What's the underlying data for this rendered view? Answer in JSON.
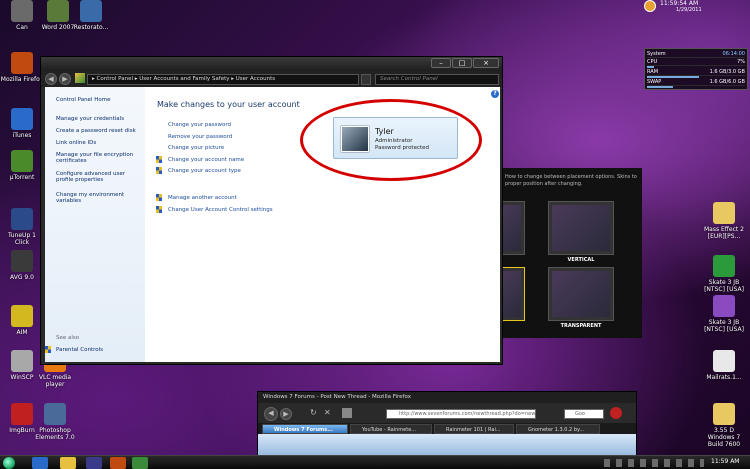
{
  "desktop": {
    "icons_left": [
      {
        "label": "Can",
        "color": "#6a6a6a"
      },
      {
        "label": "Word 2007",
        "color": "#5a7a3a"
      },
      {
        "label": "Restorato...",
        "color": "#3a6aa8"
      },
      {
        "label": "Mozilla Firefox",
        "color": "#c04a10"
      },
      {
        "label": "iTunes",
        "color": "#2a6ac8"
      },
      {
        "label": "µTorrent",
        "color": "#4a8a2a"
      },
      {
        "label": "TuneUp 1 Click",
        "color": "#2a4a8a"
      },
      {
        "label": "AVG 9.0",
        "color": "#3a3a3a"
      },
      {
        "label": "AIM",
        "color": "#d4b820"
      },
      {
        "label": "WinSCP",
        "color": "#a8a8a8"
      },
      {
        "label": "VLC media player",
        "color": "#e87a10"
      },
      {
        "label": "ImgBurn",
        "color": "#c02020"
      },
      {
        "label": "Photoshop Elements 7.0",
        "color": "#4a6a9a"
      }
    ],
    "icons_right": [
      {
        "label": "Mass Effect 2 [EUR][PS...",
        "color": "#e8c860"
      },
      {
        "label": "Skate 3 JB [NTSC] [USA]",
        "color": "#2a9a3a"
      },
      {
        "label": "Skate 3 JB [NTSC] [USA]",
        "color": "#8a4ac0"
      },
      {
        "label": "Mailrats.1...",
        "color": "#e8e8e8"
      },
      {
        "label": "3.55 D Windows 7 Build 7600",
        "color": "#e8c860"
      }
    ]
  },
  "gadgets": {
    "clock_time": "11:59:54 AM",
    "clock_date": "1/29/2011",
    "system_title": "System",
    "system_uptime": "06:14:00",
    "cpu_label": "CPU",
    "cpu_value": "7%",
    "cpu_fraction": 0.07,
    "ram_label": "RAM",
    "ram_value": "1.6 GB/3.0 GB",
    "ram_fraction": 0.53,
    "swap_label": "SWAP",
    "swap_value": "1.6 GB/6.0 GB",
    "swap_fraction": 0.27
  },
  "rainmeter": {
    "text": "How to change between placement options. Skins to proper position after changing.",
    "label_vertical": "VERTICAL",
    "label_transparent": "TRANSPARENT"
  },
  "control_panel": {
    "breadcrumb": [
      "Control Panel",
      "User Accounts and Family Safety",
      "User Accounts"
    ],
    "breadcrumb_sep": "▸",
    "search_placeholder": "Search Control Panel",
    "help": "?",
    "sidebar": {
      "home": "Control Panel Home",
      "links": [
        "Manage your credentials",
        "Create a password reset disk",
        "Link online IDs",
        "Manage your file encryption certificates",
        "Configure advanced user profile properties",
        "Change my environment variables"
      ],
      "see_also": "See also",
      "parental_controls": "Parental Controls"
    },
    "heading": "Make changes to your user account",
    "links": [
      {
        "label": "Change your password",
        "shield": false
      },
      {
        "label": "Remove your password",
        "shield": false
      },
      {
        "label": "Change your picture",
        "shield": false
      },
      {
        "label": "Change your account name",
        "shield": true
      },
      {
        "label": "Change your account type",
        "shield": true
      }
    ],
    "links_secondary": [
      {
        "label": "Manage another account",
        "shield": true
      },
      {
        "label": "Change User Account Control settings",
        "shield": true
      }
    ],
    "user": {
      "name": "Tyler",
      "role": "Administrator",
      "status": "Password protected"
    }
  },
  "firefox": {
    "title": "Windows 7 Forums - Post New Thread - Mozilla Firefox",
    "url": "http://www.sevenforums.com/newthread.php?do=newth...",
    "search_text": "Goo",
    "tabs": [
      {
        "label": "Windows 7 Forums...",
        "active": true
      },
      {
        "label": "YouTube - Rainmete...",
        "active": false
      },
      {
        "label": "Rainmeter 101 | Rai...",
        "active": false
      },
      {
        "label": "Gnometer 1.3.0.2 by...",
        "active": false
      }
    ]
  },
  "taskbar": {
    "time": "11:59 AM"
  },
  "colors": {
    "highlight": "#d40000",
    "link": "#1a4a9a"
  }
}
